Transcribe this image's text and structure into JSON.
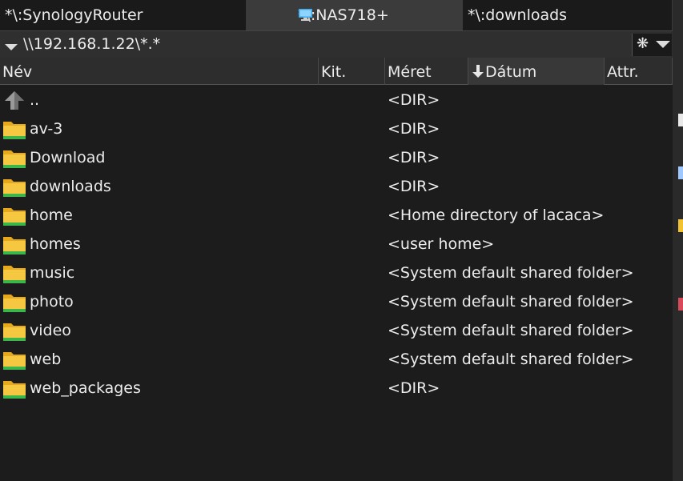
{
  "tabs": [
    {
      "label": "*\\:SynologyRouter"
    },
    {
      "label": "*\\:NAS718+",
      "icon": "monitor-icon",
      "active": true
    },
    {
      "label": "*\\:downloads"
    }
  ],
  "path": "\\\\192.168.1.22\\*.*",
  "filter_symbol": "❋",
  "columns": {
    "name": "Név",
    "ext": "Kit.",
    "size": "Méret",
    "date": "Dátum",
    "attr": "Attr."
  },
  "rows": [
    {
      "name": "..",
      "size": "<DIR>",
      "icon": "up-arrow-icon"
    },
    {
      "name": "av-3",
      "size": "<DIR>",
      "icon": "folder-icon"
    },
    {
      "name": "Download",
      "size": "<DIR>",
      "icon": "folder-icon"
    },
    {
      "name": "downloads",
      "size": "<DIR>",
      "icon": "folder-icon"
    },
    {
      "name": "home",
      "size": "<Home directory of lacaca>",
      "icon": "folder-icon"
    },
    {
      "name": "homes",
      "size": "<user home>",
      "icon": "folder-icon"
    },
    {
      "name": "music",
      "size": "<System default shared folder>",
      "icon": "folder-icon"
    },
    {
      "name": "photo",
      "size": "<System default shared folder>",
      "icon": "folder-icon"
    },
    {
      "name": "video",
      "size": "<System default shared folder>",
      "icon": "folder-icon"
    },
    {
      "name": "web",
      "size": "<System default shared folder>",
      "icon": "folder-icon"
    },
    {
      "name": "web_packages",
      "size": "<DIR>",
      "icon": "folder-icon"
    }
  ],
  "colors": {
    "background": "#1c1c1c",
    "header": "#2d2d2d",
    "active_tab": "#3b3b3b",
    "text": "#ececec",
    "folder": "#f2c230",
    "folder_stripe": "#3cb54a"
  }
}
